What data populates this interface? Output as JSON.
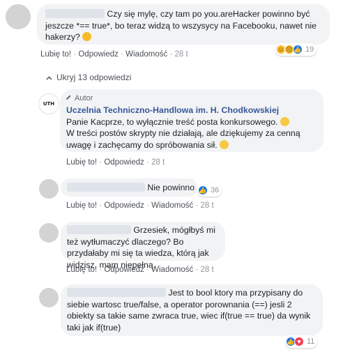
{
  "comment1": {
    "text": "Czy się mylę, czy tam po you.areHacker powinno być jeszcze *== true*, bo teraz widzą to wszysycy na Facebooku, nawet nie hakerzy?",
    "emoji_icon": "thinking-face-icon",
    "like_label": "Lubię to!",
    "reply_label": "Odpowiedz",
    "message_label": "Wiadomość",
    "time": "28 t",
    "reactions": [
      "haha-icon",
      "sad-icon",
      "like-icon"
    ],
    "reaction_count": "19"
  },
  "replies_toggle": {
    "label": "Ukryj 13 odpowiedzi",
    "icon": "chevron-up-icon"
  },
  "comment2": {
    "badge_icon": "pencil-icon",
    "badge_label": "Autor",
    "logo_text": "UTH",
    "author": "Uczelnia Techniczno-Handlowa im. H. Chodkowskiej",
    "line1": "Panie Kacprze, to wyłącznie treść posta konkursowego.",
    "line2": "W treści postów skrypty nie działają, ale dziękujemy za cenną uwagę i zachęcamy do spróbowania sił.",
    "like_label": "Lubię to!",
    "reply_label": "Odpowiedz",
    "time": "28 t"
  },
  "comment3": {
    "text": "Nie powinno",
    "like_label": "Lubię to!",
    "reply_label": "Odpowiedz",
    "message_label": "Wiadomość",
    "time": "28 t",
    "reactions": [
      "like-icon"
    ],
    "reaction_count": "36"
  },
  "comment4": {
    "text": "Grzesiek, mógłbyś mi też wytłumaczyć dlaczego? Bo przydałaby mi się ta wiedza, którą jak widzisz, mam niepełną.",
    "like_label": "Lubię to!",
    "reply_label": "Odpowiedz",
    "message_label": "Wiadomość",
    "time": "28 t"
  },
  "comment5": {
    "text": "Jest to bool ktory ma przypisany do siebie wartosc true/false, a operator porownania (==) jesli 2 obiekty sa takie same zwraca true, wiec if(true == true) da wynik taki jak if(true)",
    "reactions": [
      "like-icon",
      "love-icon"
    ],
    "reaction_count": "11"
  },
  "colors": {
    "link": "#385898",
    "meta": "#90949c",
    "bubble": "#f2f3f5",
    "like": "#1877f2",
    "love": "#f33e58",
    "haha": "#f7b928"
  }
}
